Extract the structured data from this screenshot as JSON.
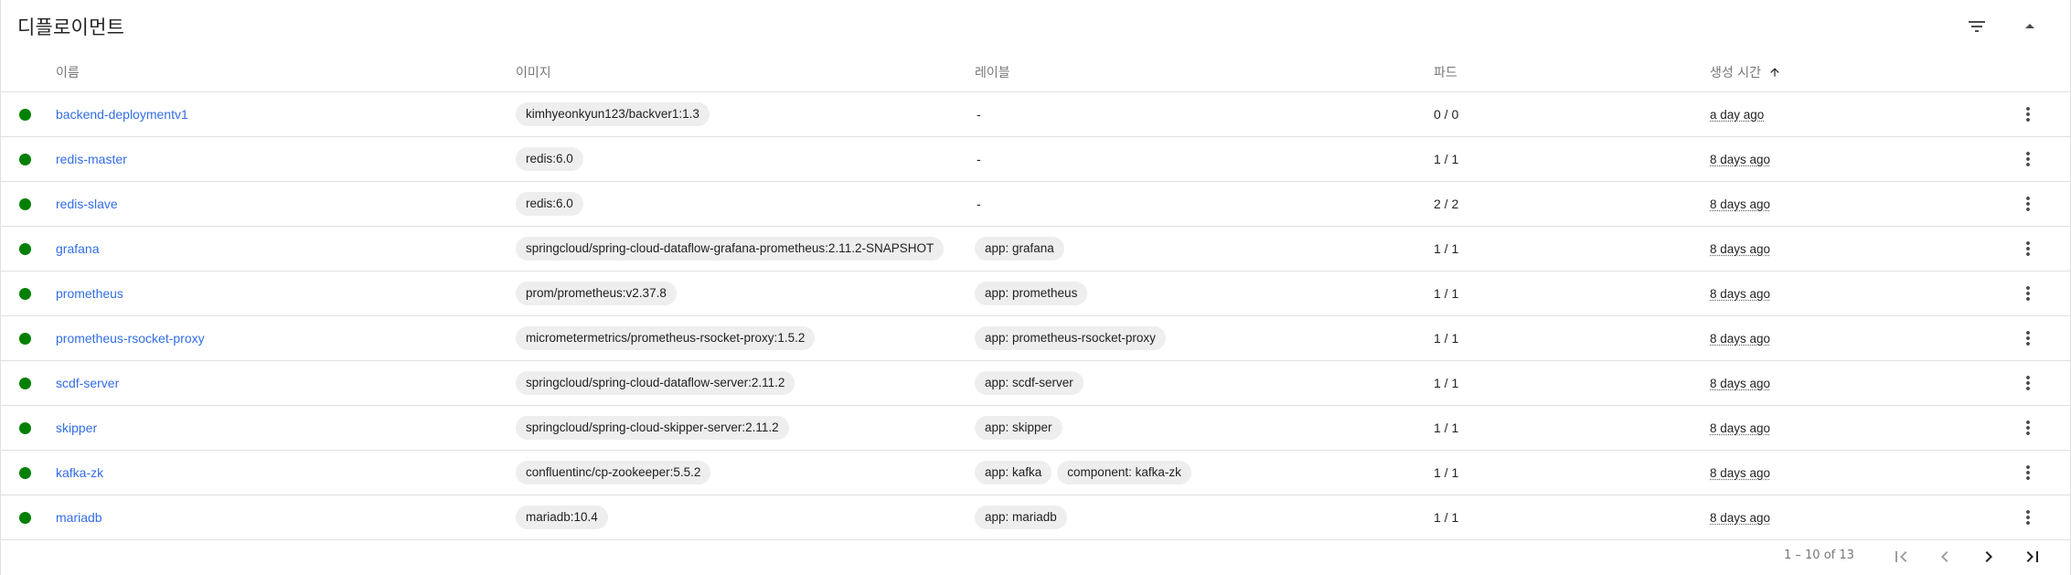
{
  "header": {
    "title": "디플로이먼트",
    "filter_icon": "filter-list-icon",
    "collapse_icon": "expand-less-icon"
  },
  "table": {
    "columns": {
      "name": "이름",
      "image": "이미지",
      "labels": "레이블",
      "pods": "파드",
      "created": "생성 시간"
    },
    "sort_icon": "arrow-upward-icon",
    "rows": [
      {
        "status": "running",
        "name": "backend-deploymentv1",
        "images": [
          "kimhyeonkyun123/backver1:1.3"
        ],
        "labels": [],
        "labels_empty": "-",
        "pods": "0 / 0",
        "created": "a day ago"
      },
      {
        "status": "running",
        "name": "redis-master",
        "images": [
          "redis:6.0"
        ],
        "labels": [],
        "labels_empty": "-",
        "pods": "1 / 1",
        "created": "8 days ago"
      },
      {
        "status": "running",
        "name": "redis-slave",
        "images": [
          "redis:6.0"
        ],
        "labels": [],
        "labels_empty": "-",
        "pods": "2 / 2",
        "created": "8 days ago"
      },
      {
        "status": "running",
        "name": "grafana",
        "images": [
          "springcloud/spring-cloud-dataflow-grafana-prometheus:2.11.2-SNAPSHOT"
        ],
        "labels": [
          "app: grafana"
        ],
        "labels_empty": "",
        "pods": "1 / 1",
        "created": "8 days ago"
      },
      {
        "status": "running",
        "name": "prometheus",
        "images": [
          "prom/prometheus:v2.37.8"
        ],
        "labels": [
          "app: prometheus"
        ],
        "labels_empty": "",
        "pods": "1 / 1",
        "created": "8 days ago"
      },
      {
        "status": "running",
        "name": "prometheus-rsocket-proxy",
        "images": [
          "micrometermetrics/prometheus-rsocket-proxy:1.5.2"
        ],
        "labels": [
          "app: prometheus-rsocket-proxy"
        ],
        "labels_empty": "",
        "pods": "1 / 1",
        "created": "8 days ago"
      },
      {
        "status": "running",
        "name": "scdf-server",
        "images": [
          "springcloud/spring-cloud-dataflow-server:2.11.2"
        ],
        "labels": [
          "app: scdf-server"
        ],
        "labels_empty": "",
        "pods": "1 / 1",
        "created": "8 days ago"
      },
      {
        "status": "running",
        "name": "skipper",
        "images": [
          "springcloud/spring-cloud-skipper-server:2.11.2"
        ],
        "labels": [
          "app: skipper"
        ],
        "labels_empty": "",
        "pods": "1 / 1",
        "created": "8 days ago"
      },
      {
        "status": "running",
        "name": "kafka-zk",
        "images": [
          "confluentinc/cp-zookeeper:5.5.2"
        ],
        "labels": [
          "app: kafka",
          "component: kafka-zk"
        ],
        "labels_empty": "",
        "pods": "1 / 1",
        "created": "8 days ago"
      },
      {
        "status": "running",
        "name": "mariadb",
        "images": [
          "mariadb:10.4"
        ],
        "labels": [
          "app: mariadb"
        ],
        "labels_empty": "",
        "pods": "1 / 1",
        "created": "8 days ago"
      }
    ],
    "row_menu_icon": "more-vert-icon"
  },
  "paginator": {
    "range_label": "1 – 10 of 13",
    "first_icon": "first-page-icon",
    "prev_icon": "chevron-left-icon",
    "next_icon": "chevron-right-icon",
    "last_icon": "last-page-icon"
  },
  "colors": {
    "link": "#326de6",
    "status_running": "#008000",
    "chip_bg": "#eeeeee",
    "divider": "#e0e0e0"
  }
}
